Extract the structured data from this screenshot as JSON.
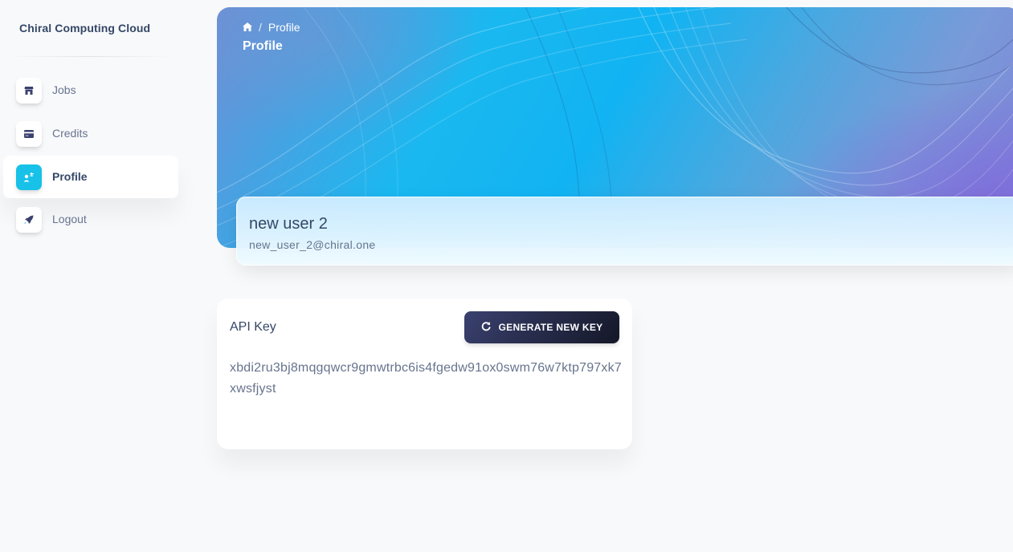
{
  "app": {
    "brand": "Chiral Computing Cloud"
  },
  "sidebar": {
    "items": [
      {
        "label": "Jobs",
        "icon": "shop-icon",
        "active": false
      },
      {
        "label": "Credits",
        "icon": "credit-card-icon",
        "active": false
      },
      {
        "label": "Profile",
        "icon": "user-icon",
        "active": true
      },
      {
        "label": "Logout",
        "icon": "rocket-icon",
        "active": false
      }
    ]
  },
  "header": {
    "breadcrumb": {
      "home_icon": "home-icon",
      "separator": "/",
      "current": "Profile"
    },
    "title": "Profile"
  },
  "profile": {
    "name": "new user 2",
    "email": "new_user_2@chiral.one"
  },
  "api_key": {
    "title": "API Key",
    "button_label": "GENERATE NEW KEY",
    "button_icon": "refresh-icon",
    "value": "xbdi2ru3bj8mqgqwcr9gmwtrbc6is4fgedw91ox0swm76w7ktp797xk7xwsfjyst"
  },
  "colors": {
    "text_primary": "#344767",
    "text_secondary": "#67748e",
    "accent": "#17c1e8",
    "button_dark": "#1e2240",
    "background": "#f8f9fb"
  }
}
